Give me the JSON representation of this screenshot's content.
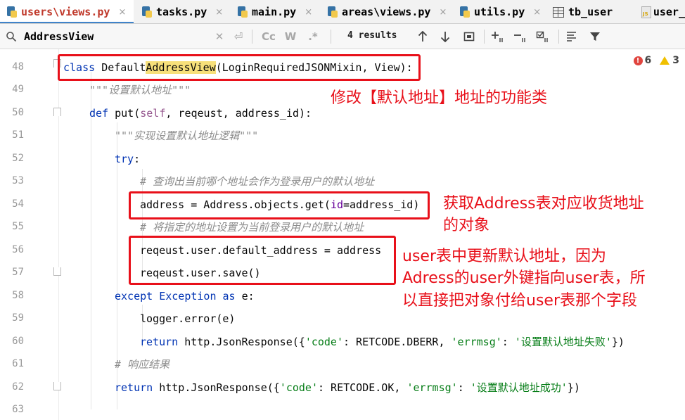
{
  "tabs": [
    {
      "label": "users\\views.py",
      "icon": "python-file-icon",
      "active": true
    },
    {
      "label": "tasks.py",
      "icon": "python-file-icon",
      "active": false
    },
    {
      "label": "main.py",
      "icon": "python-file-icon",
      "active": false
    },
    {
      "label": "areas\\views.py",
      "icon": "python-file-icon",
      "active": false
    },
    {
      "label": "utils.py",
      "icon": "python-file-icon",
      "active": false
    },
    {
      "label": "tb_user",
      "icon": "table-icon",
      "active": false
    },
    {
      "label": "user_",
      "icon": "js-file-icon",
      "active": false
    }
  ],
  "tab_close_glyph": "×",
  "find": {
    "query": "AddressView",
    "results": "4 results",
    "options": {
      "match_case": "Cc",
      "words": "W",
      "regex": ".*"
    }
  },
  "inspections": {
    "errors": "6",
    "warnings": "3"
  },
  "colors": {
    "annotation_red": "#e8101a",
    "highlight": "#f7e07a",
    "keyword": "#0033b3",
    "string": "#067d17",
    "comment": "#8c8c8c"
  },
  "lines": [
    {
      "n": "48"
    },
    {
      "n": "49"
    },
    {
      "n": "50"
    },
    {
      "n": "51"
    },
    {
      "n": "52"
    },
    {
      "n": "53"
    },
    {
      "n": "54"
    },
    {
      "n": "55"
    },
    {
      "n": "56"
    },
    {
      "n": "57"
    },
    {
      "n": "58"
    },
    {
      "n": "59"
    },
    {
      "n": "60"
    },
    {
      "n": "61"
    },
    {
      "n": "62"
    },
    {
      "n": "63"
    }
  ],
  "code": {
    "l48": {
      "kw": "class",
      "pre": "Default",
      "match": "AddressView",
      "post": "(LoginRequiredJSONMixin, View):"
    },
    "l49": {
      "doc": "\"\"\"设置默认地址\"\"\""
    },
    "l50": {
      "kw": "def",
      "name": "put(",
      "self": "self",
      "rest": ", reqeust, address_id):"
    },
    "l51": {
      "doc": "\"\"\"实现设置默认地址逻辑\"\"\""
    },
    "l52": {
      "kw": "try",
      "colon": ":"
    },
    "l53": {
      "cmt": "# 查询出当前哪个地址会作为登录用户的默认地址"
    },
    "l54": {
      "pre": "address = Address.objects.get(",
      "param": "id",
      "post": "=address_id)"
    },
    "l55": {
      "cmt": "# 将指定的地址设置为当前登录用户的默认地址"
    },
    "l56": {
      "text": "reqeust.user.default_address = address"
    },
    "l57": {
      "text": "reqeust.user.save()"
    },
    "l58": {
      "kw1": "except",
      "mid": " ",
      "kw2": "Exception",
      "mid2": " ",
      "kw3": "as",
      "rest": " e:"
    },
    "l59": {
      "text": "logger.error(e)"
    },
    "l60": {
      "kw": "return",
      "pre": " http.JsonResponse({",
      "s1": "'code'",
      "m1": ": RETCODE.DBERR, ",
      "s2": "'errmsg'",
      "m2": ": ",
      "s3": "'设置默认地址失败'",
      "post": "})"
    },
    "l61": {
      "cmt": "# 响应结果"
    },
    "l62": {
      "kw": "return",
      "pre": " http.JsonResponse({",
      "s1": "'code'",
      "m1": ": RETCODE.OK, ",
      "s2": "'errmsg'",
      "m2": ": ",
      "s3": "'设置默认地址成功'",
      "post": "})"
    }
  },
  "annotations": {
    "a1": "修改【默认地址】地址的功能类",
    "a2_line1": "获取Address表对应收货地址",
    "a2_line2": "的对象",
    "a3_line1": "user表中更新默认地址，因为",
    "a3_line2": "Adress的user外键指向user表，所",
    "a3_line3": "以直接把对象付给user表那个字段"
  }
}
